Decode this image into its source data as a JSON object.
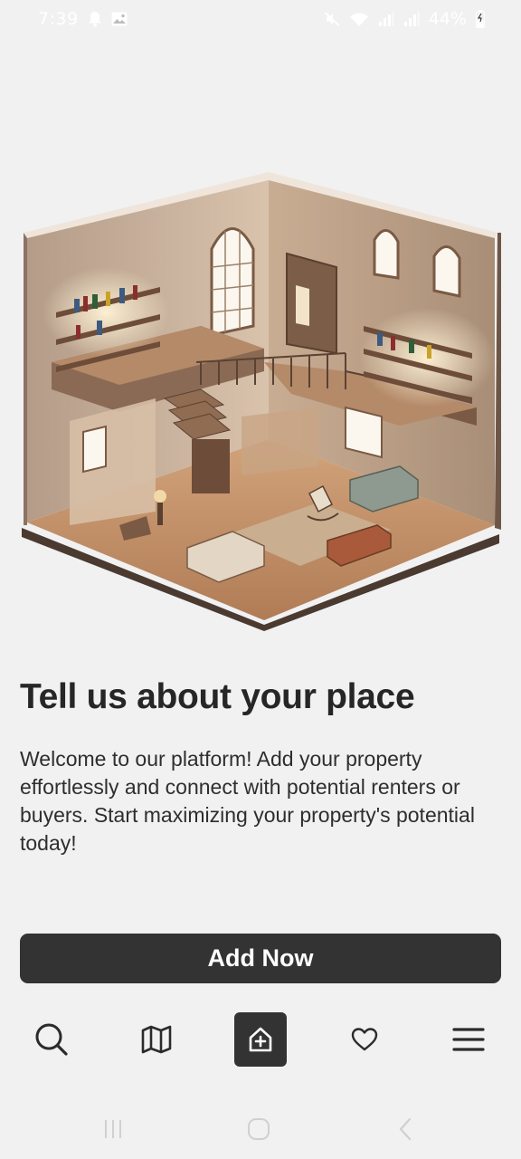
{
  "status_bar": {
    "time": "7:39",
    "battery": "44%",
    "left_icons": [
      "notification-bell-icon",
      "image-icon"
    ],
    "right_icons": [
      "mute-icon",
      "wifi-icon",
      "signal-icon",
      "signal-icon",
      "battery-icon"
    ]
  },
  "onboarding": {
    "title": "Tell us about your place",
    "description": "Welcome to our platform! Add your property effortlessly and connect with potential renters or buyers. Start maximizing your property's potential today!",
    "button_label": "Add Now"
  },
  "bottom_nav": {
    "items": [
      {
        "icon": "search-icon",
        "active": false
      },
      {
        "icon": "map-icon",
        "active": false
      },
      {
        "icon": "add-home-icon",
        "active": true
      },
      {
        "icon": "heart-icon",
        "active": false
      },
      {
        "icon": "menu-icon",
        "active": false
      }
    ]
  },
  "system_nav": [
    "recent-apps-icon",
    "home-icon",
    "back-icon"
  ],
  "colors": {
    "background": "#f1f1f2",
    "primary": "#333333",
    "text": "#262626",
    "on_primary": "#ffffff"
  }
}
